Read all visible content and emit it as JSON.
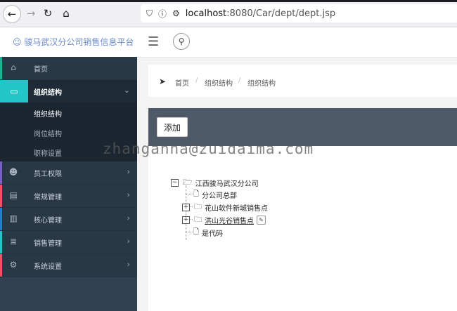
{
  "browser": {
    "url_host": "localhost",
    "url_path": ":8080/Car/dept/dept.jsp",
    "icons": [
      "back-icon",
      "forward-icon",
      "reload-icon",
      "home-icon",
      "shield-icon",
      "info-icon",
      "permissions-icon"
    ]
  },
  "header": {
    "brand": "☺ 骏马武汉分公司销售信息平台"
  },
  "sidebar": {
    "items": [
      {
        "label": "首页",
        "icon": "home-icon",
        "accent": "#1ab394"
      },
      {
        "label": "组织结构",
        "icon": "monitor-icon",
        "accent": "#23c6c8"
      },
      {
        "label": "员工权限",
        "icon": "users-icon",
        "accent": "#7b5ec4"
      },
      {
        "label": "常规管理",
        "icon": "list-icon",
        "accent": "#ed5565"
      },
      {
        "label": "核心管理",
        "icon": "chart-icon",
        "accent": "#1c84c6"
      },
      {
        "label": "销售管理",
        "icon": "list-icon",
        "accent": "#23c6c8"
      },
      {
        "label": "系统设置",
        "icon": "gears-icon",
        "accent": "#ed5565"
      }
    ],
    "sub_items": [
      {
        "label": "组织结构"
      },
      {
        "label": "岗位结构"
      },
      {
        "label": "职称设置"
      }
    ]
  },
  "breadcrumb": {
    "items": [
      "首页",
      "组织结构",
      "组织结构"
    ],
    "separator": "/"
  },
  "panel": {
    "add_label": "添加"
  },
  "tree": {
    "root": "江西骏马武汉分公司",
    "children": [
      "分公司总部",
      "花山软件新城销售点",
      "洪山光谷销售点",
      "是代码"
    ]
  },
  "watermark": "zhanganna@zuidaima.com"
}
